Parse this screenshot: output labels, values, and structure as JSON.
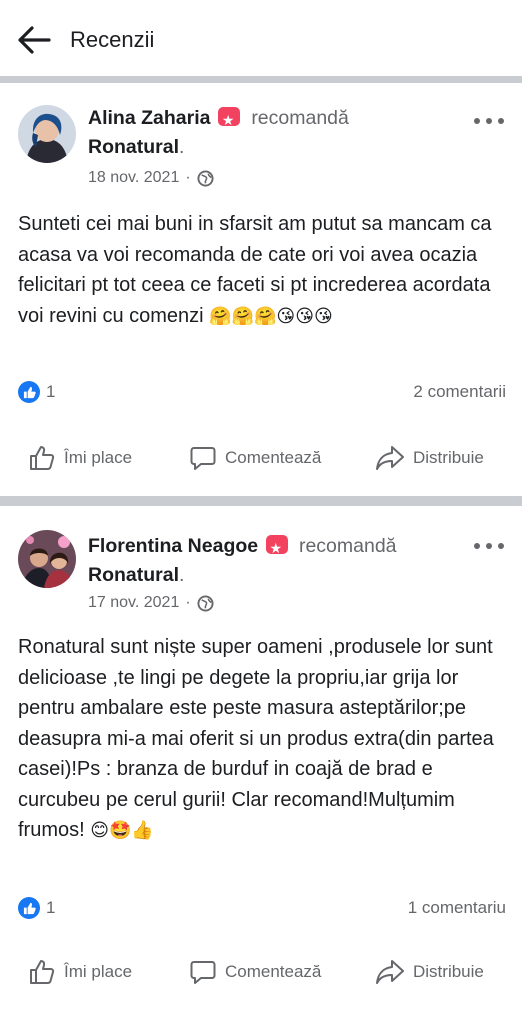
{
  "header": {
    "title": "Recenzii",
    "back_icon": "arrow-left-icon"
  },
  "posts": [
    {
      "author": "Alina Zaharia",
      "verb": "recomandă",
      "page": "Ronatural",
      "date": "18 nov. 2021",
      "body": "Sunteti cei mai buni in sfarsit am putut sa mancam ca acasa va voi recomanda de cate ori voi avea ocazia felicitari pt tot ceea ce faceti si pt increderea acordata voi revini cu comenzi",
      "emoji": "🤗🤗🤗😘😘😘",
      "likes": "1",
      "comments": "2 comentarii",
      "actions": {
        "like": "Îmi place",
        "comment": "Comentează",
        "share": "Distribuie"
      }
    },
    {
      "author": "Florentina Neagoe",
      "verb": "recomandă",
      "page": "Ronatural",
      "date": "17 nov. 2021",
      "body": "Ronatural sunt niște super oameni ,produsele lor sunt delicioase ,te lingi pe degete la propriu,iar grija lor pentru ambalare este peste masura asteptărilor;pe deasupra mi-a mai oferit si un produs extra(din partea casei)!Ps : branza de burduf in coajă de brad e curcubeu pe cerul gurii! Clar recomand!Mulțumim frumos!",
      "emoji": "😊🤩👍",
      "likes": "1",
      "comments": "1 comentariu",
      "actions": {
        "like": "Îmi place",
        "comment": "Comentează",
        "share": "Distribuie"
      }
    }
  ],
  "colors": {
    "accent": "#1877f2",
    "badge": "#f3425f",
    "muted": "#65676b",
    "separator": "#c9ccd1"
  }
}
